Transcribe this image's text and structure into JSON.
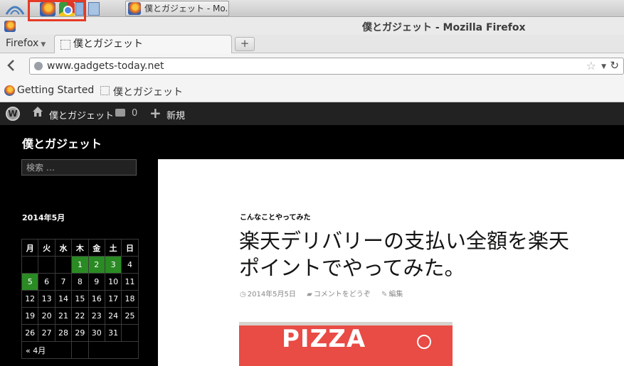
{
  "system_panel": {
    "task_title": "僕とガジェット - Mo..."
  },
  "window": {
    "title": "僕とガジェット - Mozilla Firefox"
  },
  "tabs": {
    "menu_label": "Firefox",
    "active_tab_label": "僕とガジェット",
    "new_tab_symbol": "+"
  },
  "nav": {
    "url": "www.gadgets-today.net"
  },
  "bookmarks": [
    {
      "label": "Getting Started"
    },
    {
      "label": "僕とガジェット"
    }
  ],
  "wp_admin_bar": {
    "site_name": "僕とガジェット",
    "comment_count": "0",
    "new_label": "新規"
  },
  "site": {
    "title": "僕とガジェット",
    "search_placeholder": "検索 …"
  },
  "calendar": {
    "caption": "2014年5月",
    "weekdays": [
      "月",
      "火",
      "水",
      "木",
      "金",
      "土",
      "日"
    ],
    "prev_link": "« 4月"
  },
  "post": {
    "category": "こんなことやってみた",
    "title": "楽天デリバリーの支払い全額を楽天ポイントでやってみた。",
    "date": "2014年5月5日",
    "comments": "コメントをどうぞ",
    "edit": "編集",
    "image_text": "PIZZA"
  },
  "colors": {
    "admin_bar": "#222222",
    "calendar_link": "#2a8a23",
    "highlight_box": "#e53a25"
  },
  "icons": [
    "firefox-icon",
    "chrome-icon",
    "back-arrow-icon",
    "globe-icon",
    "star-icon",
    "reload-icon",
    "wordpress-icon",
    "home-icon",
    "comment-icon",
    "plus-icon",
    "clock-icon",
    "pencil-icon"
  ]
}
